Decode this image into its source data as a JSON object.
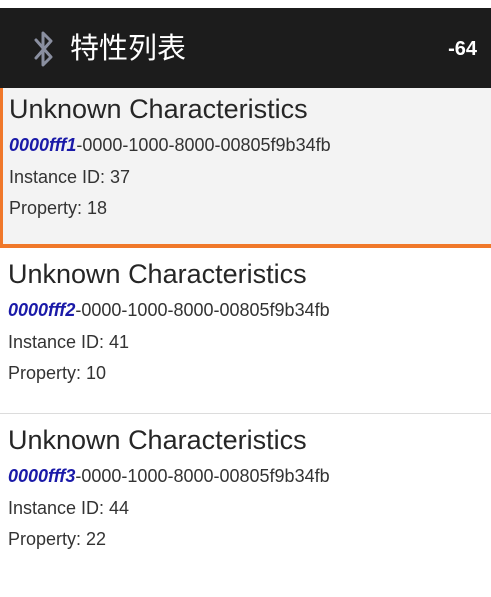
{
  "header": {
    "title": "特性列表",
    "rssi": "-64",
    "icon": "bluetooth-icon"
  },
  "characteristics": [
    {
      "name": "Unknown Characteristics",
      "uuid_short": "0000fff1",
      "uuid_rest": "-0000-1000-8000-00805f9b34fb",
      "instance_id": "Instance ID: 37",
      "property": "Property: 18",
      "selected": true
    },
    {
      "name": "Unknown Characteristics",
      "uuid_short": "0000fff2",
      "uuid_rest": "-0000-1000-8000-00805f9b34fb",
      "instance_id": "Instance ID: 41",
      "property": "Property: 10",
      "selected": false
    },
    {
      "name": "Unknown Characteristics",
      "uuid_short": "0000fff3",
      "uuid_rest": "-0000-1000-8000-00805f9b34fb",
      "instance_id": "Instance ID: 44",
      "property": "Property: 22",
      "selected": false
    }
  ],
  "colors": {
    "app_bar": "#1c1c1c",
    "selection": "#f0782a",
    "uuid_short": "#1a1aa8"
  }
}
